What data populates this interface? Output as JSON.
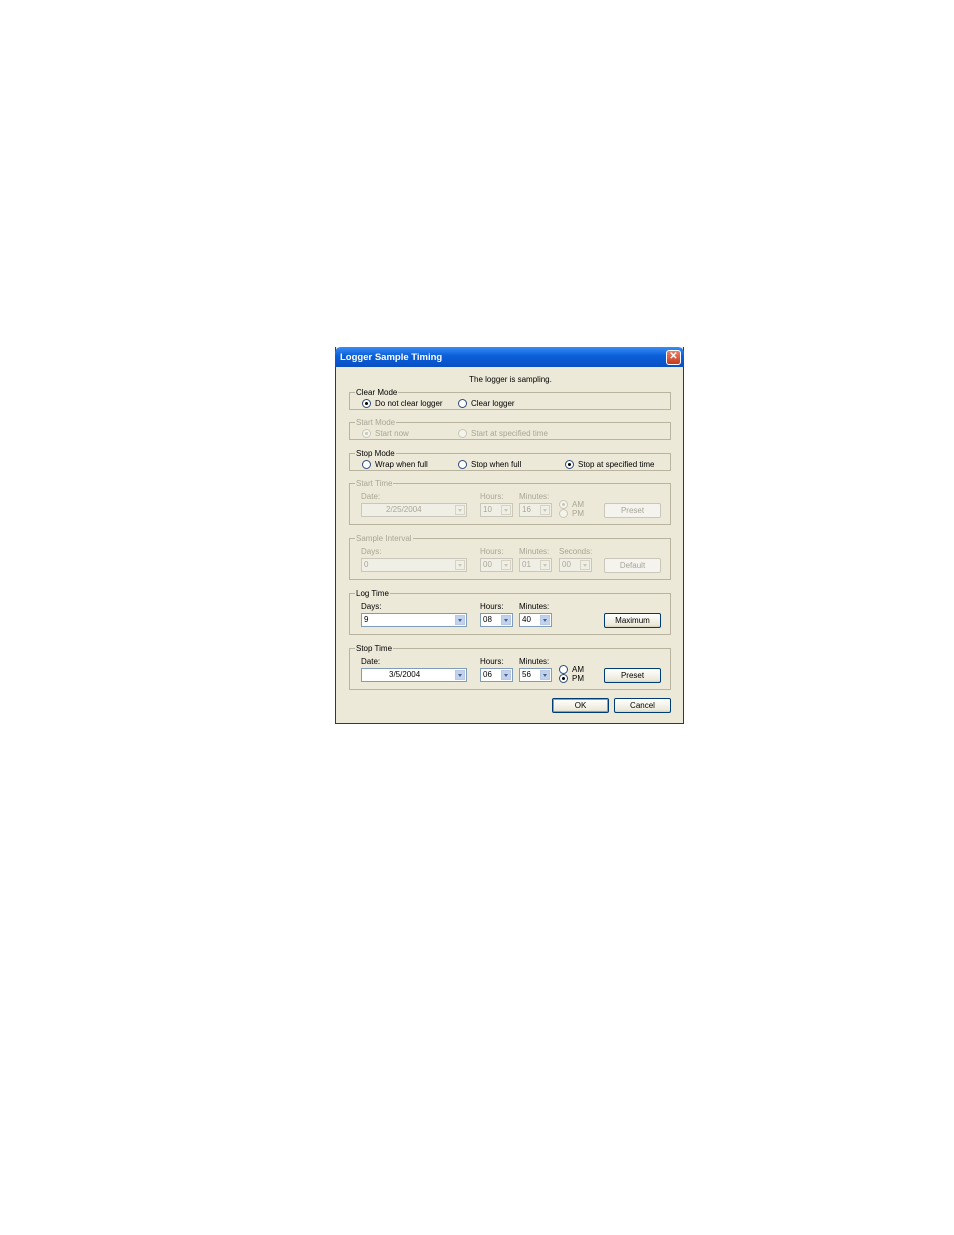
{
  "window": {
    "title": "Logger Sample Timing",
    "close_glyph": "✕"
  },
  "status_text": "The logger is sampling.",
  "clear_mode": {
    "legend": "Clear Mode",
    "options": [
      {
        "label": "Do not clear logger",
        "checked": true
      },
      {
        "label": "Clear logger",
        "checked": false
      }
    ]
  },
  "start_mode": {
    "legend": "Start Mode",
    "disabled": true,
    "options": [
      {
        "label": "Start now",
        "checked": true
      },
      {
        "label": "Start at specified time",
        "checked": false
      }
    ]
  },
  "stop_mode": {
    "legend": "Stop Mode",
    "options": [
      {
        "label": "Wrap when full",
        "checked": false
      },
      {
        "label": "Stop when full",
        "checked": false
      },
      {
        "label": "Stop at specified time",
        "checked": true
      }
    ]
  },
  "start_time": {
    "legend": "Start Time",
    "disabled": true,
    "date_label": "Date:",
    "date_value": "2/25/2004",
    "hours_label": "Hours:",
    "hours_value": "10",
    "minutes_label": "Minutes:",
    "minutes_value": "16",
    "am_label": "AM",
    "pm_label": "PM",
    "am_selected": true,
    "button": "Preset"
  },
  "sample_interval": {
    "legend": "Sample Interval",
    "disabled": true,
    "days_label": "Days:",
    "days_value": "0",
    "hours_label": "Hours:",
    "hours_value": "00",
    "minutes_label": "Minutes:",
    "minutes_value": "01",
    "seconds_label": "Seconds:",
    "seconds_value": "00",
    "button": "Default"
  },
  "log_time": {
    "legend": "Log Time",
    "days_label": "Days:",
    "days_value": "9",
    "hours_label": "Hours:",
    "hours_value": "08",
    "minutes_label": "Minutes:",
    "minutes_value": "40",
    "button": "Maximum"
  },
  "stop_time": {
    "legend": "Stop Time",
    "date_label": "Date:",
    "date_value": "3/5/2004",
    "hours_label": "Hours:",
    "hours_value": "06",
    "minutes_label": "Minutes:",
    "minutes_value": "56",
    "am_label": "AM",
    "pm_label": "PM",
    "am_selected": false,
    "button": "Preset"
  },
  "buttons": {
    "ok": "OK",
    "cancel": "Cancel"
  }
}
